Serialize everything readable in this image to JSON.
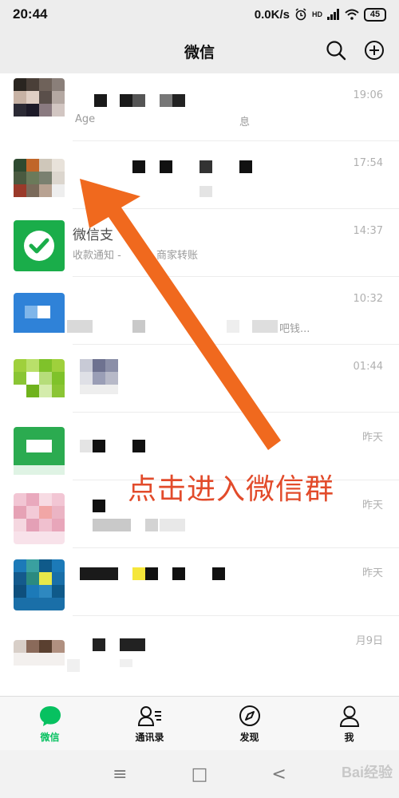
{
  "status_bar": {
    "time": "20:44",
    "speed": "0.0K/s",
    "network": "HD",
    "battery": "45"
  },
  "title_bar": {
    "title": "微信",
    "search_icon": "search-icon",
    "add_icon": "plus-circle-icon"
  },
  "chats": [
    {
      "title": "",
      "preview": "Age",
      "preview_tail": "息",
      "time": "19:06"
    },
    {
      "title": "",
      "preview": "",
      "time": "17:54"
    },
    {
      "title": "微信支",
      "title_tail": "t",
      "preview": "收款通知 -",
      "preview_tail": "商家转账",
      "time": "14:37"
    },
    {
      "title": "",
      "preview": "",
      "preview_tail": "吧钱...",
      "time": "10:32"
    },
    {
      "title": "",
      "preview": "",
      "time": "01:44"
    },
    {
      "title": "",
      "preview": "",
      "time": "昨天"
    },
    {
      "title": "",
      "preview": "",
      "time": "昨天"
    },
    {
      "title": "",
      "preview": "",
      "time": "昨天"
    },
    {
      "title": "",
      "preview": "",
      "time": "月9日"
    }
  ],
  "annotation": {
    "text": "点击进入微信群"
  },
  "tabs": [
    {
      "label": "微信",
      "icon": "chat-bubble-icon",
      "active": true
    },
    {
      "label": "通讯录",
      "icon": "contacts-icon",
      "active": false
    },
    {
      "label": "发现",
      "icon": "compass-icon",
      "active": false
    },
    {
      "label": "我",
      "icon": "person-icon",
      "active": false
    }
  ],
  "nav": {
    "menu": "≡",
    "home": "□",
    "back": "<"
  },
  "watermark": "Bai经验",
  "colors": {
    "accent_green": "#07c160",
    "annotation_red": "#e24b2b",
    "arrow_orange": "#f0691e"
  }
}
